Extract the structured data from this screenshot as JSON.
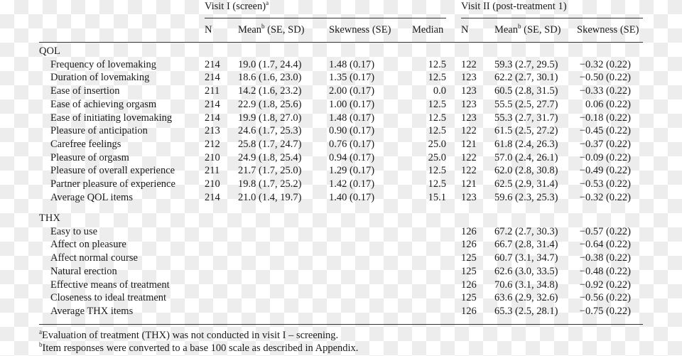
{
  "table": {
    "group_headers": [
      {
        "label": "Visit I (screen)",
        "sup": "a"
      },
      {
        "label": "Visit II (post-treatment 1)",
        "sup": ""
      }
    ],
    "column_headers": {
      "visit1": [
        {
          "label": "N",
          "sup": ""
        },
        {
          "label": "Mean",
          "sup": "b",
          "suffix": " (SE, SD)"
        },
        {
          "label": "Skewness (SE)",
          "sup": ""
        },
        {
          "label": "Median",
          "sup": ""
        }
      ],
      "visit2": [
        {
          "label": "N",
          "sup": ""
        },
        {
          "label": "Mean",
          "sup": "b",
          "suffix": " (SE, SD)"
        },
        {
          "label": "Skewness (SE)",
          "sup": ""
        }
      ]
    },
    "sections": [
      {
        "title": "QOL",
        "rows": [
          {
            "label": "Frequency of lovemaking",
            "v1_n": "214",
            "v1_mean": "19.0 (1.7, 24.4)",
            "v1_skew": "1.48 (0.17)",
            "v1_median": "12.5",
            "v2_n": "122",
            "v2_mean": "59.3 (2.7, 29.5)",
            "v2_skew": "−0.32 (0.22)"
          },
          {
            "label": "Duration of lovemaking",
            "v1_n": "214",
            "v1_mean": "18.6 (1.6, 23.0)",
            "v1_skew": "1.35 (0.17)",
            "v1_median": "12.5",
            "v2_n": "123",
            "v2_mean": "62.2 (2.7, 30.1)",
            "v2_skew": "−0.50 (0.22)"
          },
          {
            "label": "Ease of insertion",
            "v1_n": "211",
            "v1_mean": "14.2 (1.6, 23.2)",
            "v1_skew": "2.00 (0.17)",
            "v1_median": "0.0",
            "v2_n": "123",
            "v2_mean": "60.5 (2.8, 31.5)",
            "v2_skew": "−0.33 (0.22)"
          },
          {
            "label": "Ease of achieving orgasm",
            "v1_n": "214",
            "v1_mean": "22.9 (1.8, 25.6)",
            "v1_skew": "1.00 (0.17)",
            "v1_median": "12.5",
            "v2_n": "123",
            "v2_mean": "55.5 (2.5, 27.7)",
            "v2_skew": "0.06 (0.22)"
          },
          {
            "label": "Ease of initiating lovemaking",
            "v1_n": "214",
            "v1_mean": "19.9 (1.8, 27.0)",
            "v1_skew": "1.48 (0.17)",
            "v1_median": "12.5",
            "v2_n": "123",
            "v2_mean": "55.3 (2.7, 31.7)",
            "v2_skew": "−0.18 (0.22)"
          },
          {
            "label": "Pleasure of anticipation",
            "v1_n": "213",
            "v1_mean": "24.6 (1.7, 25.3)",
            "v1_skew": "0.90 (0.17)",
            "v1_median": "12.5",
            "v2_n": "122",
            "v2_mean": "61.5 (2.5, 27.2)",
            "v2_skew": "−0.45 (0.22)"
          },
          {
            "label": "Carefree feelings",
            "v1_n": "212",
            "v1_mean": "25.8 (1.7, 24.7)",
            "v1_skew": "0.76 (0.17)",
            "v1_median": "25.0",
            "v2_n": "121",
            "v2_mean": "61.8 (2.4, 26.3)",
            "v2_skew": "−0.37 (0.22)"
          },
          {
            "label": "Pleasure of orgasm",
            "v1_n": "210",
            "v1_mean": "24.9 (1.8, 25.4)",
            "v1_skew": "0.94 (0.17)",
            "v1_median": "25.0",
            "v2_n": "122",
            "v2_mean": "57.0 (2.4, 26.1)",
            "v2_skew": "−0.09 (0.22)"
          },
          {
            "label": "Pleasure of overall experience",
            "v1_n": "211",
            "v1_mean": "21.7 (1.7, 25.0)",
            "v1_skew": "1.29 (0.17)",
            "v1_median": "12.5",
            "v2_n": "122",
            "v2_mean": "62.0 (2.8, 30.8)",
            "v2_skew": "−0.49 (0.22)"
          },
          {
            "label": "Partner pleasure of experience",
            "v1_n": "210",
            "v1_mean": "19.8 (1.7, 25.2)",
            "v1_skew": "1.42 (0.17)",
            "v1_median": "12.5",
            "v2_n": "121",
            "v2_mean": "62.5 (2.9, 31.4)",
            "v2_skew": "−0.53 (0.22)"
          },
          {
            "label": "Average QOL items",
            "v1_n": "214",
            "v1_mean": "21.0 (1.4, 19.7)",
            "v1_skew": "1.40 (0.17)",
            "v1_median": "15.1",
            "v2_n": "123",
            "v2_mean": "59.6 (2.3, 25.3)",
            "v2_skew": "−0.32 (0.22)"
          }
        ]
      },
      {
        "title": "THX",
        "rows": [
          {
            "label": "Easy to use",
            "v1_n": "",
            "v1_mean": "",
            "v1_skew": "",
            "v1_median": "",
            "v2_n": "126",
            "v2_mean": "67.2 (2.7, 30.3)",
            "v2_skew": "−0.57 (0.22)"
          },
          {
            "label": "Affect on pleasure",
            "v1_n": "",
            "v1_mean": "",
            "v1_skew": "",
            "v1_median": "",
            "v2_n": "126",
            "v2_mean": "66.7 (2.8, 31.4)",
            "v2_skew": "−0.64 (0.22)"
          },
          {
            "label": "Affect normal course",
            "v1_n": "",
            "v1_mean": "",
            "v1_skew": "",
            "v1_median": "",
            "v2_n": "125",
            "v2_mean": "60.7 (3.1, 34.7)",
            "v2_skew": "−0.38 (0.22)"
          },
          {
            "label": "Natural erection",
            "v1_n": "",
            "v1_mean": "",
            "v1_skew": "",
            "v1_median": "",
            "v2_n": "125",
            "v2_mean": "62.6 (3.0, 33.5)",
            "v2_skew": "−0.48 (0.22)"
          },
          {
            "label": "Effective means of treatment",
            "v1_n": "",
            "v1_mean": "",
            "v1_skew": "",
            "v1_median": "",
            "v2_n": "126",
            "v2_mean": "70.6 (3.1, 34.8)",
            "v2_skew": "−0.92 (0.22)"
          },
          {
            "label": "Closeness to ideal treatment",
            "v1_n": "",
            "v1_mean": "",
            "v1_skew": "",
            "v1_median": "",
            "v2_n": "125",
            "v2_mean": "63.6 (2.9, 32.6)",
            "v2_skew": "−0.56 (0.22)"
          },
          {
            "label": "Average THX items",
            "v1_n": "",
            "v1_mean": "",
            "v1_skew": "",
            "v1_median": "",
            "v2_n": "126",
            "v2_mean": "65.3 (2.5, 28.1)",
            "v2_skew": "−0.75 (0.22)"
          }
        ]
      }
    ],
    "footnotes": [
      {
        "mark": "a",
        "text": "Evaluation of treatment (THX) was not conducted in visit I – screening."
      },
      {
        "mark": "b",
        "text": "Item responses were converted to a base 100 scale as described in Appendix."
      }
    ]
  }
}
